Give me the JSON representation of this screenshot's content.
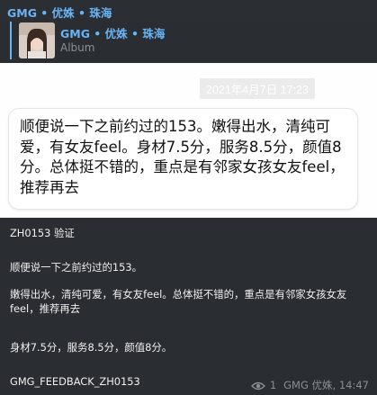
{
  "header": {
    "channel_name": "GMG • 优姝 • 珠海"
  },
  "reply": {
    "title": "GMG • 优姝 • 珠海",
    "subtitle": "Album"
  },
  "card": {
    "date": "2021年4月7日 17:23",
    "message": "顺便说一下之前约过的153。嫩得出水，清纯可爱，有女友feel。身材7.5分，服务8.5分，颜值8分。总体挺不错的，重点是有邻家女孩女友feel，推荐再去"
  },
  "caption": {
    "code_line": "ZH0153 验证",
    "line1": "顺便说一下之前约过的153。",
    "line2": "嫩得出水，清纯可爱，有女友feel。总体挺不错的，重点是有邻家女孩女友feel，推荐再去",
    "line3": "身材7.5分，服务8.5分，颜值8分。",
    "tag": "GMG_FEEDBACK_ZH0153"
  },
  "meta": {
    "views": "1",
    "author_time": "GMG 优姝, 14:47",
    "icon": "eye-icon"
  },
  "colors": {
    "background": "#2a2d31",
    "accent": "#6ab3f3",
    "muted": "#8a8f96"
  }
}
